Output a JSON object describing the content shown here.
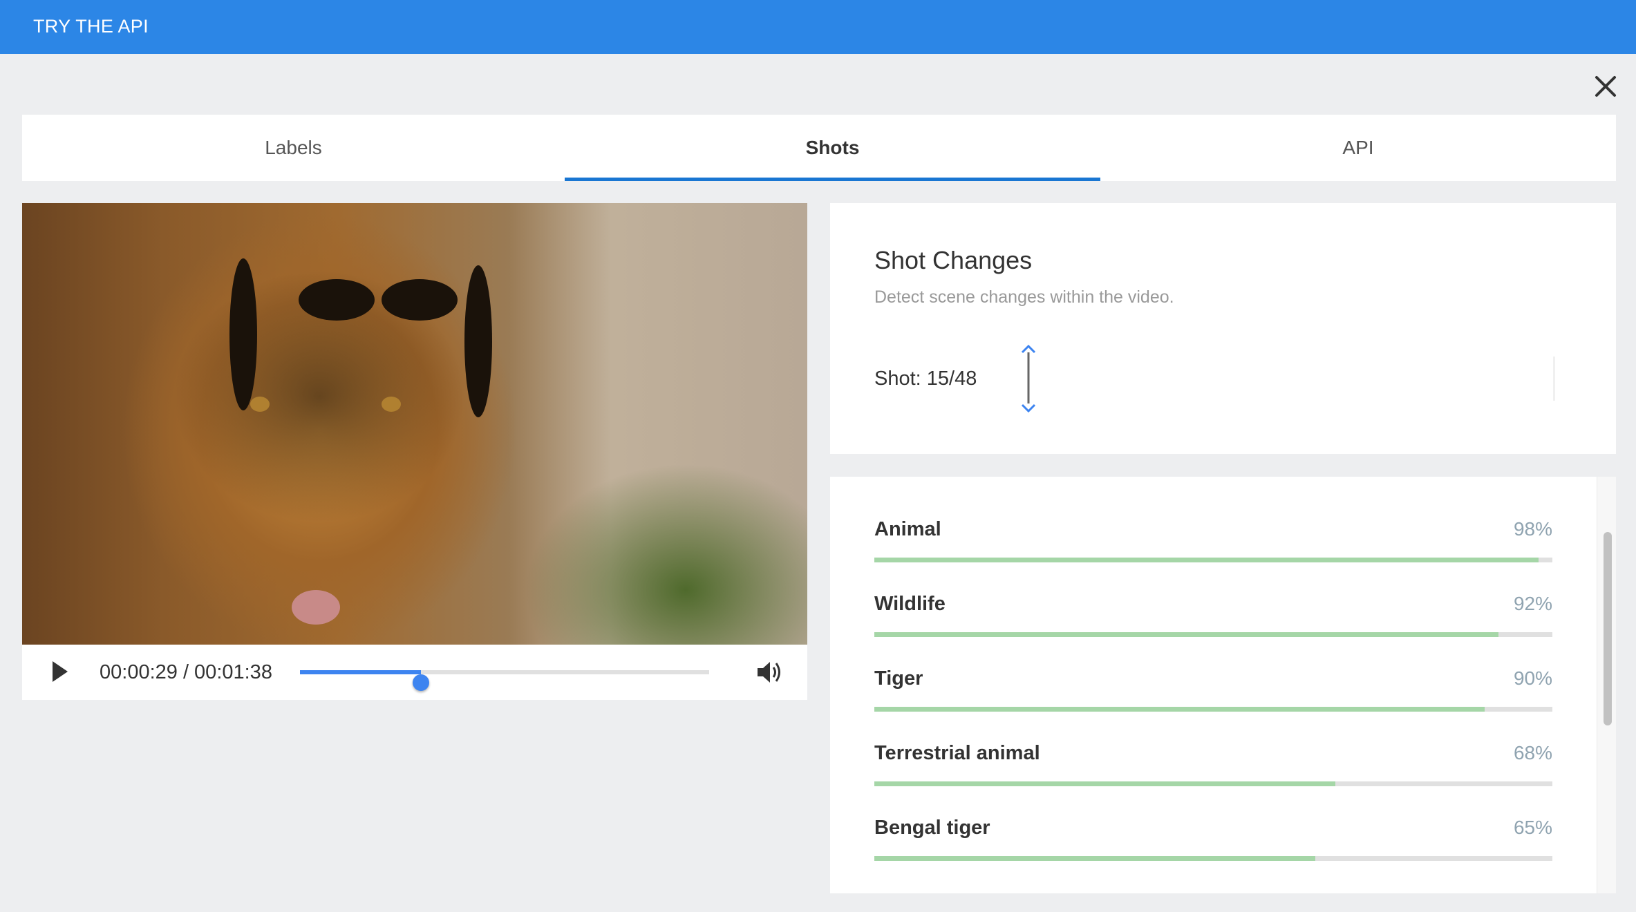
{
  "header": {
    "title": "TRY THE API",
    "close_icon": "close-icon"
  },
  "tabs": [
    {
      "label": "Labels",
      "active": false
    },
    {
      "label": "Shots",
      "active": true
    },
    {
      "label": "API",
      "active": false
    }
  ],
  "video": {
    "current_time": "00:00:29",
    "duration": "00:01:38",
    "time_display": "00:00:29 / 00:01:38",
    "progress_fraction": 0.296,
    "play_icon": "play-icon",
    "volume_icon": "volume-icon",
    "accent_color": "#3d84f0"
  },
  "shot_changes": {
    "title": "Shot Changes",
    "description": "Detect scene changes within the video.",
    "counter": "Shot: 15/48",
    "current_shot": 15,
    "total_shots": 48,
    "nav_icon": "up-down-arrow-icon"
  },
  "labels": [
    {
      "name": "Animal",
      "percent_text": "98%",
      "value": 0.98
    },
    {
      "name": "Wildlife",
      "percent_text": "92%",
      "value": 0.92
    },
    {
      "name": "Tiger",
      "percent_text": "90%",
      "value": 0.9
    },
    {
      "name": "Terrestrial animal",
      "percent_text": "68%",
      "value": 0.68
    },
    {
      "name": "Bengal tiger",
      "percent_text": "65%",
      "value": 0.65
    }
  ],
  "colors": {
    "header_bg": "#2c86e6",
    "tab_underline": "#1976d2",
    "bar_fill": "#a5d6a7",
    "bar_track": "#e0e0e0"
  }
}
